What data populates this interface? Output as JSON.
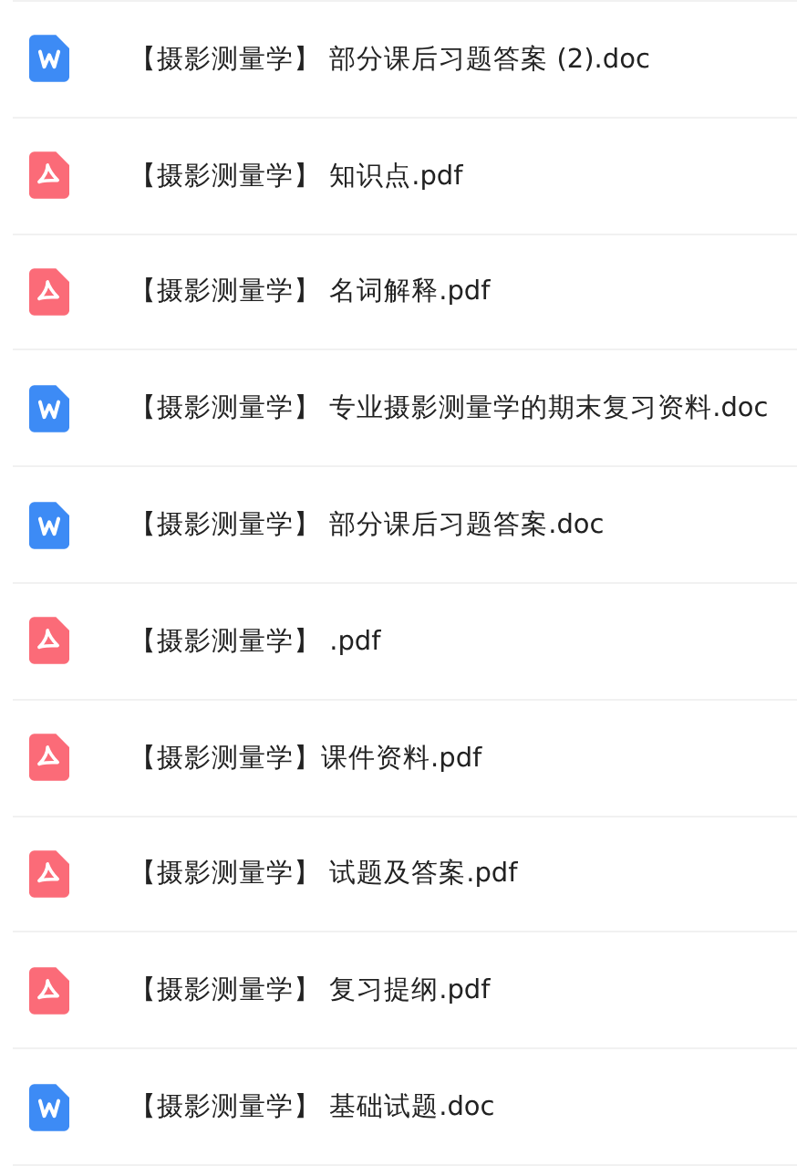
{
  "files": [
    {
      "kind": "doc",
      "name": "【摄影测量学】 部分课后习题答案 (2).doc"
    },
    {
      "kind": "pdf",
      "name": "【摄影测量学】 知识点.pdf"
    },
    {
      "kind": "pdf",
      "name": "【摄影测量学】 名词解释.pdf"
    },
    {
      "kind": "doc",
      "name": "【摄影测量学】 专业摄影测量学的期末复习资料.doc"
    },
    {
      "kind": "doc",
      "name": "【摄影测量学】 部分课后习题答案.doc"
    },
    {
      "kind": "pdf",
      "name": "【摄影测量学】 .pdf"
    },
    {
      "kind": "pdf",
      "name": "【摄影测量学】课件资料.pdf"
    },
    {
      "kind": "pdf",
      "name": "【摄影测量学】 试题及答案.pdf"
    },
    {
      "kind": "pdf",
      "name": "【摄影测量学】 复习提纲.pdf"
    },
    {
      "kind": "doc",
      "name": "【摄影测量学】 基础试题.doc"
    }
  ]
}
